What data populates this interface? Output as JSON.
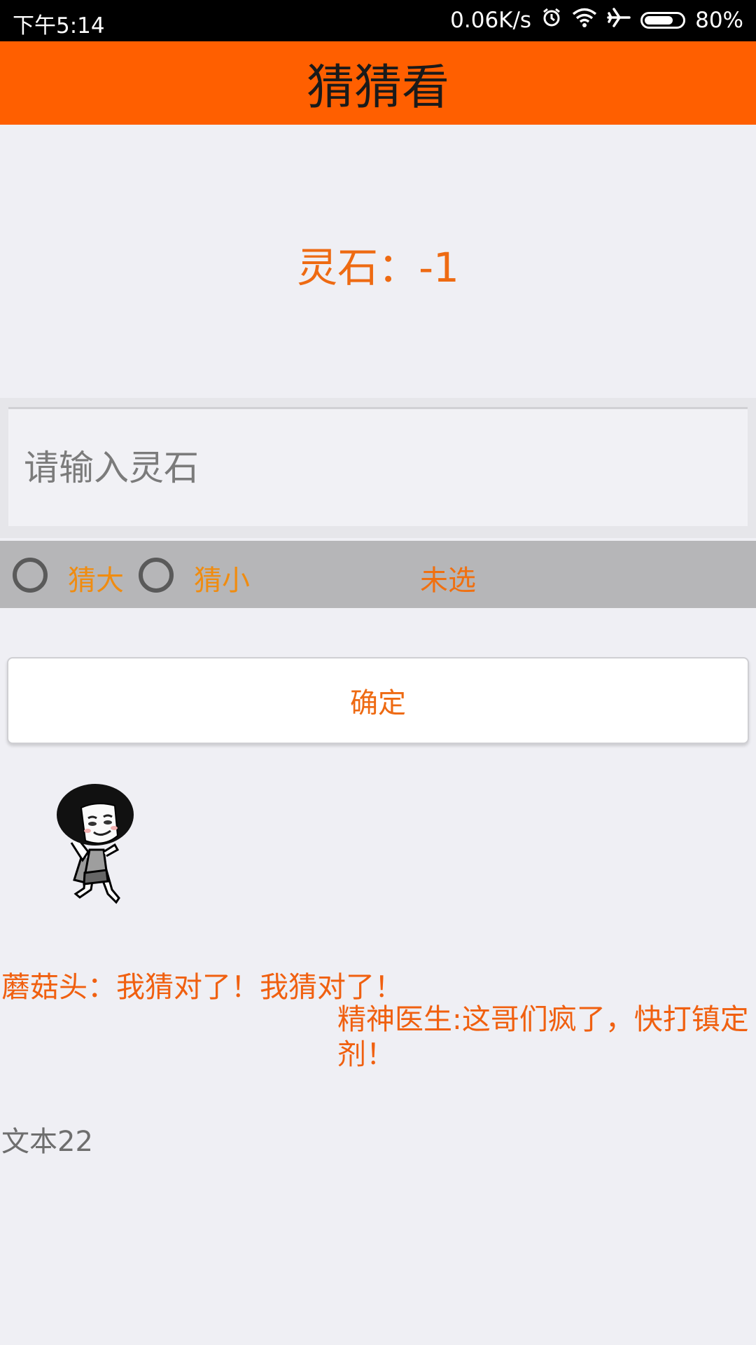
{
  "status_bar": {
    "time": "下午5:14",
    "network_speed": "0.06K/s",
    "icons": [
      "alarm-icon",
      "wifi-icon",
      "airplane-mode-icon",
      "battery-icon"
    ],
    "battery_percent": "80%",
    "battery_level": 0.8
  },
  "app_bar": {
    "title": "猜猜看"
  },
  "stone_display": {
    "text": "灵石：-1"
  },
  "stone_input": {
    "value": "",
    "placeholder": "请输入灵石"
  },
  "guess_options": {
    "options": [
      {
        "label": "猜大",
        "checked": false
      },
      {
        "label": "猜小",
        "checked": false
      }
    ],
    "selection_status": "未选"
  },
  "confirm_button": {
    "label": "确定"
  },
  "dialog": {
    "line1": "蘑菇头：我猜对了！我猜对了！",
    "line2": "精神医生:这哥们疯了，快打镇定剂！"
  },
  "footer_text": "文本22",
  "colors": {
    "accent": "#ff5f00",
    "text_orange": "#ee6a12",
    "radio_label_orange": "#f08c10",
    "background": "#efeff4"
  }
}
